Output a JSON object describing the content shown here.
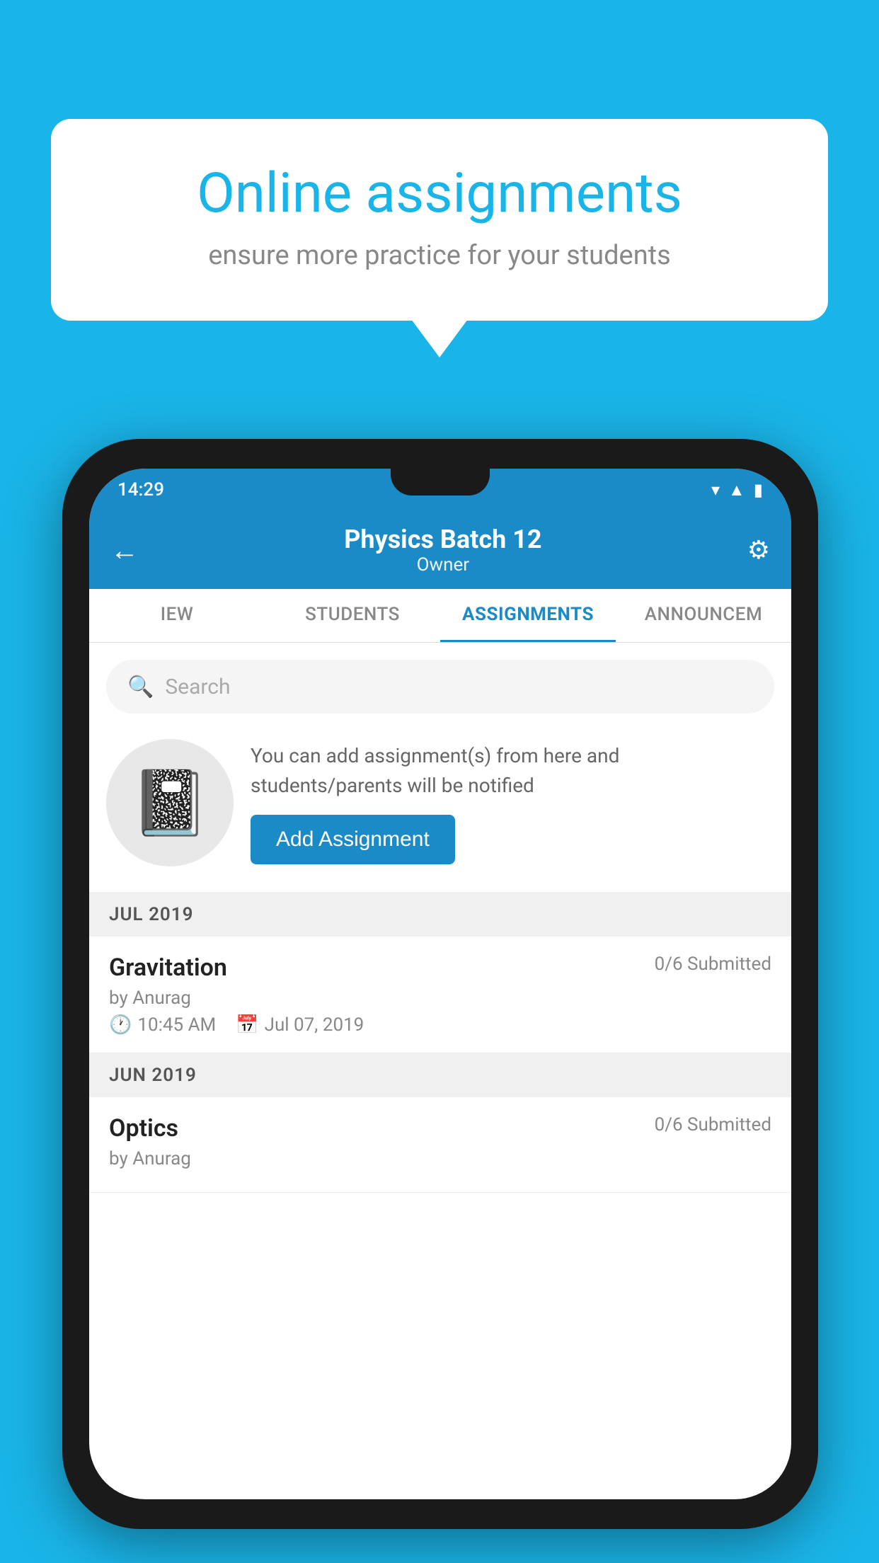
{
  "background_color": "#1ab5e8",
  "speech_bubble": {
    "title": "Online assignments",
    "subtitle": "ensure more practice for your students"
  },
  "phone": {
    "status_bar": {
      "time": "14:29",
      "icons": [
        "wifi",
        "signal",
        "battery"
      ]
    },
    "app_bar": {
      "title": "Physics Batch 12",
      "subtitle": "Owner",
      "back_label": "←",
      "settings_label": "⚙"
    },
    "tabs": [
      {
        "label": "IEW",
        "active": false
      },
      {
        "label": "STUDENTS",
        "active": false
      },
      {
        "label": "ASSIGNMENTS",
        "active": true
      },
      {
        "label": "ANNOUNCEM",
        "active": false
      }
    ],
    "search": {
      "placeholder": "Search"
    },
    "info_card": {
      "text": "You can add assignment(s) from here and students/parents will be notified",
      "button_label": "Add Assignment"
    },
    "sections": [
      {
        "header": "JUL 2019",
        "assignments": [
          {
            "name": "Gravitation",
            "submitted": "0/6 Submitted",
            "by": "by Anurag",
            "time": "10:45 AM",
            "date": "Jul 07, 2019"
          }
        ]
      },
      {
        "header": "JUN 2019",
        "assignments": [
          {
            "name": "Optics",
            "submitted": "0/6 Submitted",
            "by": "by Anurag",
            "time": "",
            "date": ""
          }
        ]
      }
    ]
  }
}
